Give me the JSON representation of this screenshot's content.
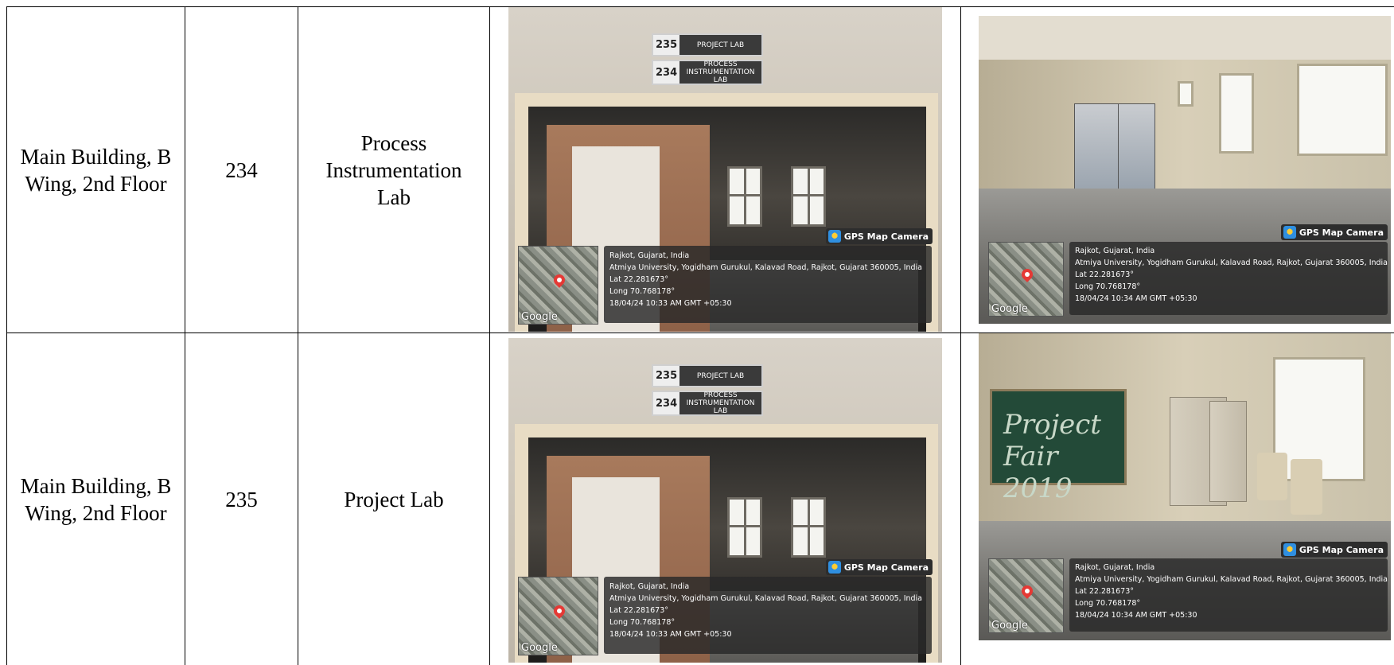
{
  "rows": [
    {
      "building": "Main Building, B Wing, 2nd Floor",
      "room_no": "234",
      "room_name": "Process Instrumentation Lab",
      "photo1": {
        "badge": "GPS Map Camera",
        "signs": [
          {
            "num": "235",
            "label": "PROJECT LAB"
          },
          {
            "num": "234",
            "label": "PROCESS INSTRUMENTATION LAB"
          }
        ],
        "lines": [
          "Rajkot, Gujarat, India",
          "Atmiya University, Yogidham Gurukul, Kalavad Road, Rajkot, Gujarat 360005, India",
          "Lat 22.281673°",
          "Long 70.768178°",
          "18/04/24 10:33 AM GMT +05:30"
        ],
        "map_logo": "Google"
      },
      "photo2": {
        "badge": "GPS Map Camera",
        "lines": [
          "Rajkot, Gujarat, India",
          "Atmiya University, Yogidham Gurukul, Kalavad Road, Rajkot, Gujarat 360005, India",
          "Lat 22.281673°",
          "Long 70.768178°",
          "18/04/24 10:34 AM GMT +05:30"
        ],
        "map_logo": "Google"
      }
    },
    {
      "building": "Main Building, B Wing, 2nd Floor",
      "room_no": "235",
      "room_name": "Project Lab",
      "photo1": {
        "badge": "GPS Map Camera",
        "signs": [
          {
            "num": "235",
            "label": "PROJECT LAB"
          },
          {
            "num": "234",
            "label": "PROCESS INSTRUMENTATION LAB"
          }
        ],
        "lines": [
          "Rajkot, Gujarat, India",
          "Atmiya University, Yogidham Gurukul, Kalavad Road, Rajkot, Gujarat 360005, India",
          "Lat 22.281673°",
          "Long 70.768178°",
          "18/04/24 10:33 AM GMT +05:30"
        ],
        "map_logo": "Google"
      },
      "photo2": {
        "badge": "GPS Map Camera",
        "board_text": "Project Fair 2019",
        "lines": [
          "Rajkot, Gujarat, India",
          "Atmiya University, Yogidham Gurukul, Kalavad Road, Rajkot, Gujarat 360005, India",
          "Lat 22.281673°",
          "Long 70.768178°",
          "18/04/24 10:34 AM GMT +05:30"
        ],
        "map_logo": "Google"
      }
    }
  ]
}
